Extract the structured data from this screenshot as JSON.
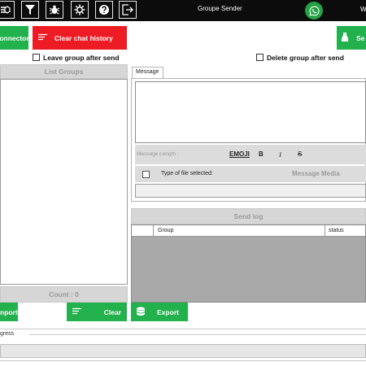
{
  "app": {
    "title": "Groupe Sender",
    "right_letter": "W"
  },
  "topbar": {
    "icons": [
      "layers-icon",
      "filter-icon",
      "bug-icon",
      "gear-icon",
      "help-icon",
      "exit-icon"
    ]
  },
  "actions": {
    "connector_label": "onnector",
    "clear_history_label": "Clear chat history",
    "send_label": "Se"
  },
  "options": {
    "leave_group_label": "Leave group after send",
    "delete_group_label": "Delete group after send"
  },
  "groups_panel": {
    "title": "List Groups",
    "count_label": "Count : 0",
    "import_label": "nport",
    "clear_label": "Clear"
  },
  "message_panel": {
    "tab_label": "Message",
    "length_label": "Message Length :",
    "emoji_label": "EMOJI",
    "bold_label": "B",
    "italic_label": "I",
    "strike_label": "S",
    "file_type_label": "Type of file selected:",
    "media_label": "Message Media"
  },
  "send_log": {
    "title": "Send log",
    "columns": [
      "Group",
      "status"
    ],
    "export_label": "Export"
  },
  "progress": {
    "label": "gress"
  },
  "colors": {
    "green": "#22b14c",
    "red": "#ed1c24",
    "topbar": "#0c0c0c",
    "whatsapp": "#25a244"
  }
}
